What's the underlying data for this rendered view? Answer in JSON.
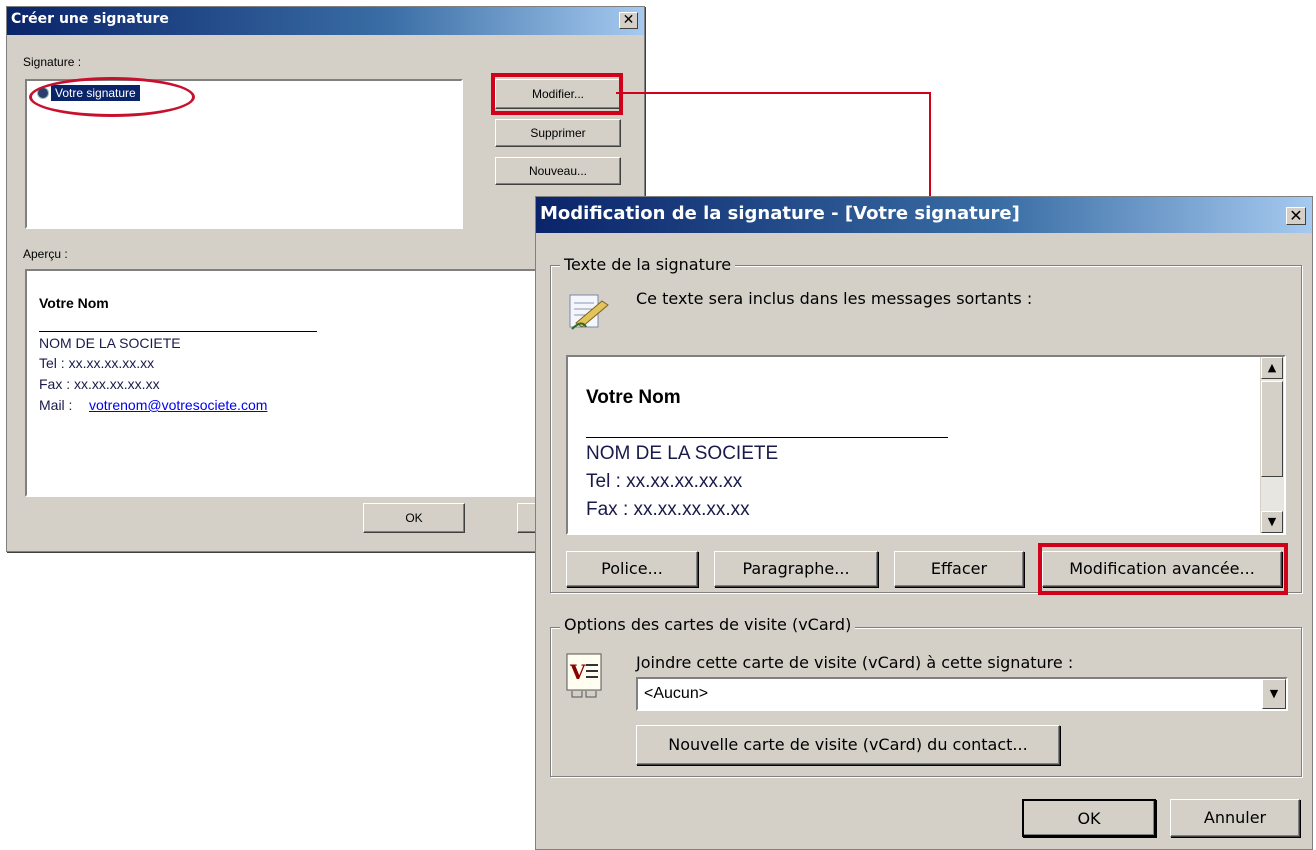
{
  "create_dialog": {
    "title": "Créer une signature",
    "signature_label": "Signature :",
    "selected_signature": "Votre signature",
    "buttons": {
      "modify": "Modifier...",
      "delete": "Supprimer",
      "new": "Nouveau...",
      "ok": "OK"
    },
    "preview_label": "Aperçu :",
    "preview": {
      "name": "Votre Nom",
      "company": "NOM DE LA SOCIETE",
      "tel": "Tel : xx.xx.xx.xx.xx",
      "fax": "Fax : xx.xx.xx.xx.xx",
      "mail_prefix": "Mail : ",
      "mail": "votrenom@votresociete.com"
    }
  },
  "edit_dialog": {
    "title": "Modification de la signature - [Votre signature]",
    "text_group": "Texte de la signature",
    "description": "Ce texte sera inclus dans les messages sortants :",
    "signature_text": {
      "name": "Votre Nom",
      "company": "NOM DE LA SOCIETE",
      "tel": "Tel : xx.xx.xx.xx.xx",
      "fax": "Fax : xx.xx.xx.xx.xx"
    },
    "buttons": {
      "font": "Police...",
      "paragraph": "Paragraphe...",
      "clear": "Effacer",
      "advanced": "Modification avancée...",
      "new_vcard": "Nouvelle carte de visite (vCard) du contact...",
      "ok": "OK",
      "cancel": "Annuler"
    },
    "vcard_group": "Options des cartes de visite (vCard)",
    "vcard_label": "Joindre cette carte de visite (vCard) à cette signature :",
    "vcard_value": "<Aucun>"
  },
  "colors": {
    "highlight": "#d0021b",
    "titlebar": "#0a246a"
  }
}
